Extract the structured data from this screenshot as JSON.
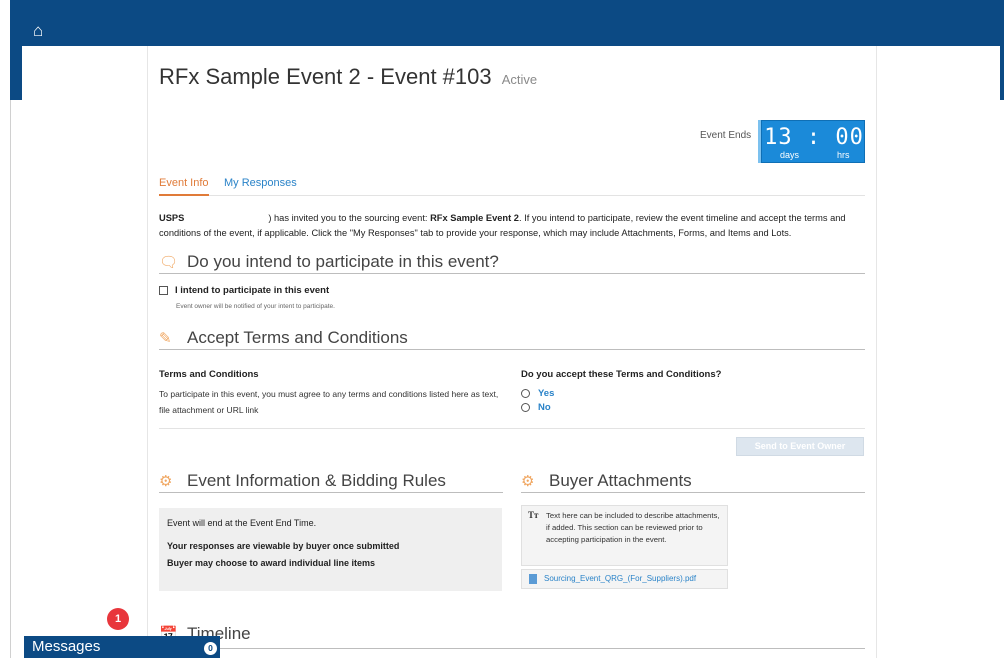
{
  "header": {
    "home_icon": "home-icon"
  },
  "event": {
    "title": "RFx Sample Event 2 - Event #103",
    "status": "Active",
    "ends_label": "Event Ends",
    "timer_value": "13 : 00",
    "timer_days": "days",
    "timer_hrs": "hrs"
  },
  "tabs": [
    {
      "label": "Event Info"
    },
    {
      "label": "My Responses"
    }
  ],
  "invite": {
    "org": "USPS",
    "text_a": ") has invited you to the sourcing event: ",
    "event_name": "RFx Sample Event 2",
    "text_b": ". If you intend to participate, review the event timeline and accept the terms and conditions of the event, if applicable. Click the \"My Responses\" tab to provide your response, which may include Attachments, Forms, and Items and Lots."
  },
  "intend": {
    "heading": "Do you intend to participate in this event?",
    "checkbox_label": "I intend to participate in this event",
    "note": "Event owner will be notified of your intent to participate."
  },
  "terms": {
    "heading": "Accept Terms and Conditions",
    "title": "Terms and Conditions",
    "desc": "To participate in this event, you must agree to any terms and conditions listed here as text, file attachment or URL link",
    "question": "Do you accept these Terms and Conditions?",
    "yes": "Yes",
    "no": "No",
    "send_button": "Send to Event Owner"
  },
  "rules": {
    "heading": "Event Information & Bidding Rules",
    "line1": "Event will end at the Event End Time.",
    "line2": "Your responses are viewable by buyer once submitted",
    "line3": "Buyer may choose to award individual line items"
  },
  "attachments": {
    "heading": "Buyer Attachments",
    "tt": "Tт",
    "desc": "Text here can be included to describe attachments, if added. This section can be reviewed prior to accepting participation in the event.",
    "file": "Sourcing_Event_QRG_(For_Suppliers).pdf"
  },
  "timeline": {
    "heading": "Timeline"
  },
  "messages": {
    "label": "Messages",
    "count": "0",
    "notification_count": "1"
  },
  "colors": {
    "header": "#0c4a84",
    "accent": "#e07b39",
    "link": "#2a83c8",
    "timer": "#1b8ad9",
    "badge": "#e8363c"
  }
}
